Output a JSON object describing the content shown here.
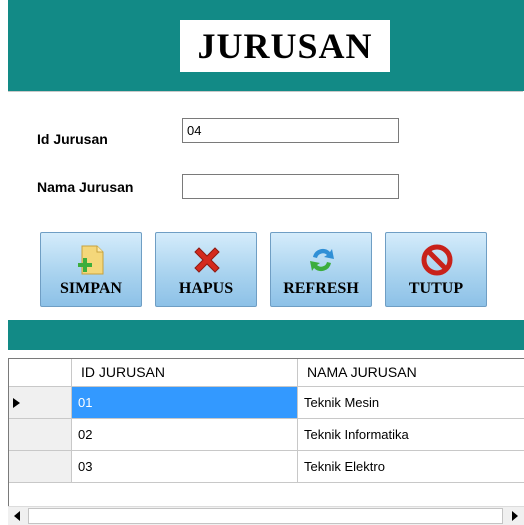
{
  "header": {
    "title": "JURUSAN"
  },
  "form": {
    "id_label": "Id Jurusan",
    "id_value": "04",
    "name_label": "Nama Jurusan",
    "name_value": ""
  },
  "buttons": {
    "save_label": "SIMPAN",
    "delete_label": "HAPUS",
    "refresh_label": "REFRESH",
    "close_label": "TUTUP"
  },
  "table": {
    "columns": [
      "ID JURUSAN",
      "NAMA JURUSAN"
    ],
    "rows": [
      {
        "id": "01",
        "name": "Teknik Mesin",
        "selected": true
      },
      {
        "id": "02",
        "name": "Teknik Informatika",
        "selected": false
      },
      {
        "id": "03",
        "name": "Teknik Elektro",
        "selected": false
      }
    ]
  },
  "icons": {
    "save": "add-document-icon",
    "delete": "red-x-icon",
    "refresh": "refresh-arrows-icon",
    "close": "no-entry-icon"
  },
  "colors": {
    "header": "#128a86",
    "selection": "#3399ff",
    "button": "#a9d3ef"
  }
}
